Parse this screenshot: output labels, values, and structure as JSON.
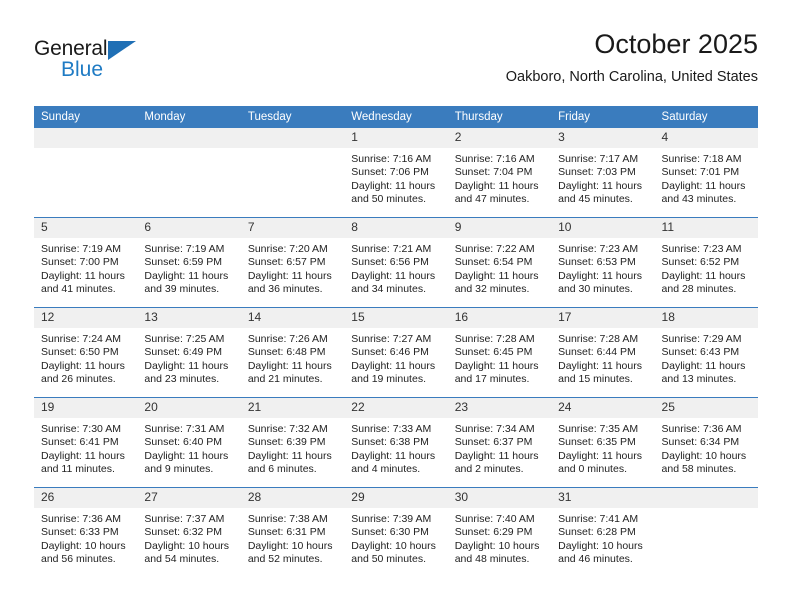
{
  "brand": {
    "name_top": "General",
    "name_bottom": "Blue",
    "accent_color": "#1F7BC4",
    "triangle_color": "#1F6FB5"
  },
  "header": {
    "title": "October 2025",
    "subtitle": "Oakboro, North Carolina, United States"
  },
  "calendar": {
    "header_background": "#3A7CBE",
    "daynum_background": "#F0F0F0",
    "weekdays": [
      "Sunday",
      "Monday",
      "Tuesday",
      "Wednesday",
      "Thursday",
      "Friday",
      "Saturday"
    ],
    "weeks": [
      [
        {
          "day": "",
          "empty": true
        },
        {
          "day": "",
          "empty": true
        },
        {
          "day": "",
          "empty": true
        },
        {
          "day": "1",
          "sunrise": "Sunrise: 7:16 AM",
          "sunset": "Sunset: 7:06 PM",
          "daylight1": "Daylight: 11 hours",
          "daylight2": "and 50 minutes."
        },
        {
          "day": "2",
          "sunrise": "Sunrise: 7:16 AM",
          "sunset": "Sunset: 7:04 PM",
          "daylight1": "Daylight: 11 hours",
          "daylight2": "and 47 minutes."
        },
        {
          "day": "3",
          "sunrise": "Sunrise: 7:17 AM",
          "sunset": "Sunset: 7:03 PM",
          "daylight1": "Daylight: 11 hours",
          "daylight2": "and 45 minutes."
        },
        {
          "day": "4",
          "sunrise": "Sunrise: 7:18 AM",
          "sunset": "Sunset: 7:01 PM",
          "daylight1": "Daylight: 11 hours",
          "daylight2": "and 43 minutes."
        }
      ],
      [
        {
          "day": "5",
          "sunrise": "Sunrise: 7:19 AM",
          "sunset": "Sunset: 7:00 PM",
          "daylight1": "Daylight: 11 hours",
          "daylight2": "and 41 minutes."
        },
        {
          "day": "6",
          "sunrise": "Sunrise: 7:19 AM",
          "sunset": "Sunset: 6:59 PM",
          "daylight1": "Daylight: 11 hours",
          "daylight2": "and 39 minutes."
        },
        {
          "day": "7",
          "sunrise": "Sunrise: 7:20 AM",
          "sunset": "Sunset: 6:57 PM",
          "daylight1": "Daylight: 11 hours",
          "daylight2": "and 36 minutes."
        },
        {
          "day": "8",
          "sunrise": "Sunrise: 7:21 AM",
          "sunset": "Sunset: 6:56 PM",
          "daylight1": "Daylight: 11 hours",
          "daylight2": "and 34 minutes."
        },
        {
          "day": "9",
          "sunrise": "Sunrise: 7:22 AM",
          "sunset": "Sunset: 6:54 PM",
          "daylight1": "Daylight: 11 hours",
          "daylight2": "and 32 minutes."
        },
        {
          "day": "10",
          "sunrise": "Sunrise: 7:23 AM",
          "sunset": "Sunset: 6:53 PM",
          "daylight1": "Daylight: 11 hours",
          "daylight2": "and 30 minutes."
        },
        {
          "day": "11",
          "sunrise": "Sunrise: 7:23 AM",
          "sunset": "Sunset: 6:52 PM",
          "daylight1": "Daylight: 11 hours",
          "daylight2": "and 28 minutes."
        }
      ],
      [
        {
          "day": "12",
          "sunrise": "Sunrise: 7:24 AM",
          "sunset": "Sunset: 6:50 PM",
          "daylight1": "Daylight: 11 hours",
          "daylight2": "and 26 minutes."
        },
        {
          "day": "13",
          "sunrise": "Sunrise: 7:25 AM",
          "sunset": "Sunset: 6:49 PM",
          "daylight1": "Daylight: 11 hours",
          "daylight2": "and 23 minutes."
        },
        {
          "day": "14",
          "sunrise": "Sunrise: 7:26 AM",
          "sunset": "Sunset: 6:48 PM",
          "daylight1": "Daylight: 11 hours",
          "daylight2": "and 21 minutes."
        },
        {
          "day": "15",
          "sunrise": "Sunrise: 7:27 AM",
          "sunset": "Sunset: 6:46 PM",
          "daylight1": "Daylight: 11 hours",
          "daylight2": "and 19 minutes."
        },
        {
          "day": "16",
          "sunrise": "Sunrise: 7:28 AM",
          "sunset": "Sunset: 6:45 PM",
          "daylight1": "Daylight: 11 hours",
          "daylight2": "and 17 minutes."
        },
        {
          "day": "17",
          "sunrise": "Sunrise: 7:28 AM",
          "sunset": "Sunset: 6:44 PM",
          "daylight1": "Daylight: 11 hours",
          "daylight2": "and 15 minutes."
        },
        {
          "day": "18",
          "sunrise": "Sunrise: 7:29 AM",
          "sunset": "Sunset: 6:43 PM",
          "daylight1": "Daylight: 11 hours",
          "daylight2": "and 13 minutes."
        }
      ],
      [
        {
          "day": "19",
          "sunrise": "Sunrise: 7:30 AM",
          "sunset": "Sunset: 6:41 PM",
          "daylight1": "Daylight: 11 hours",
          "daylight2": "and 11 minutes."
        },
        {
          "day": "20",
          "sunrise": "Sunrise: 7:31 AM",
          "sunset": "Sunset: 6:40 PM",
          "daylight1": "Daylight: 11 hours",
          "daylight2": "and 9 minutes."
        },
        {
          "day": "21",
          "sunrise": "Sunrise: 7:32 AM",
          "sunset": "Sunset: 6:39 PM",
          "daylight1": "Daylight: 11 hours",
          "daylight2": "and 6 minutes."
        },
        {
          "day": "22",
          "sunrise": "Sunrise: 7:33 AM",
          "sunset": "Sunset: 6:38 PM",
          "daylight1": "Daylight: 11 hours",
          "daylight2": "and 4 minutes."
        },
        {
          "day": "23",
          "sunrise": "Sunrise: 7:34 AM",
          "sunset": "Sunset: 6:37 PM",
          "daylight1": "Daylight: 11 hours",
          "daylight2": "and 2 minutes."
        },
        {
          "day": "24",
          "sunrise": "Sunrise: 7:35 AM",
          "sunset": "Sunset: 6:35 PM",
          "daylight1": "Daylight: 11 hours",
          "daylight2": "and 0 minutes."
        },
        {
          "day": "25",
          "sunrise": "Sunrise: 7:36 AM",
          "sunset": "Sunset: 6:34 PM",
          "daylight1": "Daylight: 10 hours",
          "daylight2": "and 58 minutes."
        }
      ],
      [
        {
          "day": "26",
          "sunrise": "Sunrise: 7:36 AM",
          "sunset": "Sunset: 6:33 PM",
          "daylight1": "Daylight: 10 hours",
          "daylight2": "and 56 minutes."
        },
        {
          "day": "27",
          "sunrise": "Sunrise: 7:37 AM",
          "sunset": "Sunset: 6:32 PM",
          "daylight1": "Daylight: 10 hours",
          "daylight2": "and 54 minutes."
        },
        {
          "day": "28",
          "sunrise": "Sunrise: 7:38 AM",
          "sunset": "Sunset: 6:31 PM",
          "daylight1": "Daylight: 10 hours",
          "daylight2": "and 52 minutes."
        },
        {
          "day": "29",
          "sunrise": "Sunrise: 7:39 AM",
          "sunset": "Sunset: 6:30 PM",
          "daylight1": "Daylight: 10 hours",
          "daylight2": "and 50 minutes."
        },
        {
          "day": "30",
          "sunrise": "Sunrise: 7:40 AM",
          "sunset": "Sunset: 6:29 PM",
          "daylight1": "Daylight: 10 hours",
          "daylight2": "and 48 minutes."
        },
        {
          "day": "31",
          "sunrise": "Sunrise: 7:41 AM",
          "sunset": "Sunset: 6:28 PM",
          "daylight1": "Daylight: 10 hours",
          "daylight2": "and 46 minutes."
        },
        {
          "day": "",
          "empty": true
        }
      ]
    ]
  }
}
